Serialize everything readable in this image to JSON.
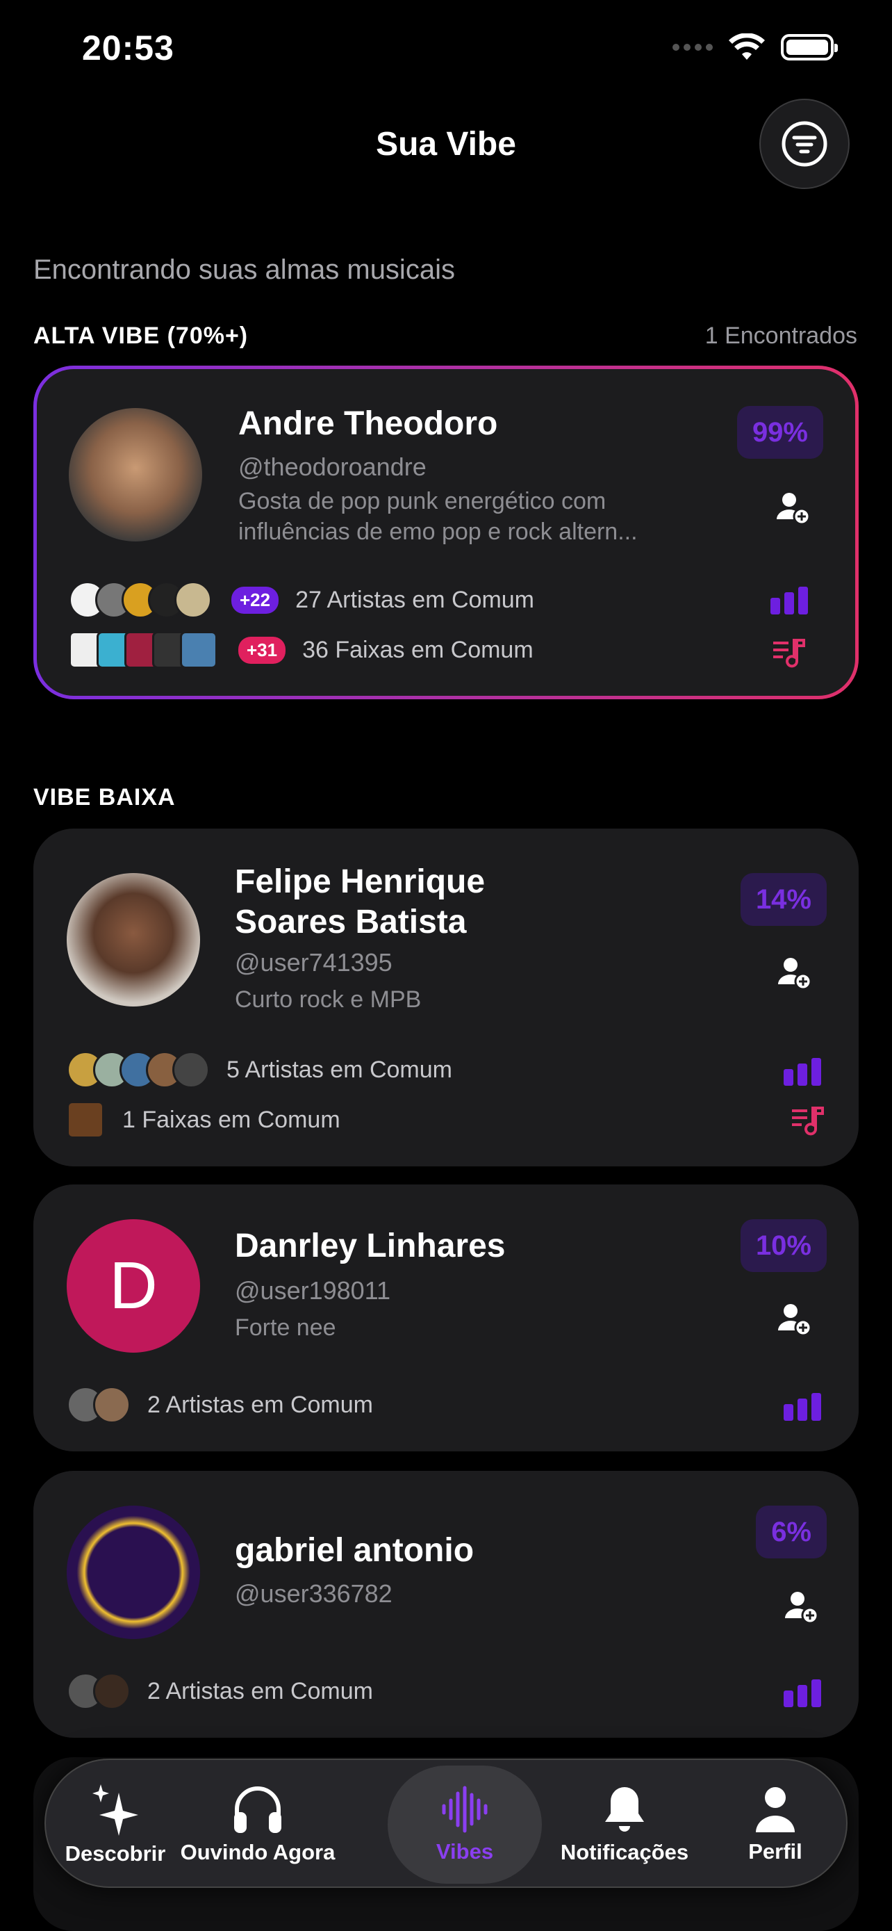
{
  "status": {
    "time": "20:53"
  },
  "header": {
    "title": "Sua Vibe",
    "filter_icon": "filter-icon"
  },
  "subtitle": "Encontrando suas almas musicais",
  "high_section": {
    "label": "ALTA VIBE (70%+)",
    "count": "1 Encontrados"
  },
  "low_section": {
    "label": "VIBE BAIXA"
  },
  "cards": [
    {
      "name": "Andre Theodoro",
      "handle": "@theodoroandre",
      "bio": "Gosta de pop punk energético com influências de emo pop e rock altern...",
      "percent": "99%",
      "artists_badge": "+22",
      "artists_text": "27 Artistas em Comum",
      "tracks_badge": "+31",
      "tracks_text": "36 Faixas em Comum"
    },
    {
      "name": "Felipe Henrique Soares Batista",
      "handle": "@user741395",
      "bio": "Curto rock e MPB",
      "percent": "14%",
      "artists_text": "5 Artistas em Comum",
      "tracks_text": "1 Faixas em Comum"
    },
    {
      "name": "Danrley Linhares",
      "initial": "D",
      "handle": "@user198011",
      "bio": "Forte nee",
      "percent": "10%",
      "artists_text": "2 Artistas em Comum"
    },
    {
      "name": "gabriel antonio",
      "handle": "@user336782",
      "percent": "6%",
      "artists_text": "2 Artistas em Comum"
    }
  ],
  "tabs": [
    {
      "label": "Descobrir",
      "icon": "sparkles-icon"
    },
    {
      "label": "Ouvindo Agora",
      "icon": "headphones-icon"
    },
    {
      "label": "Vibes",
      "icon": "waveform-icon",
      "active": true
    },
    {
      "label": "Notificações",
      "icon": "bell-icon"
    },
    {
      "label": "Perfil",
      "icon": "person-icon"
    }
  ],
  "colors": {
    "accent_purple": "#7a2fe0",
    "accent_pink": "#e0306a",
    "card_bg": "#1c1c1e"
  }
}
